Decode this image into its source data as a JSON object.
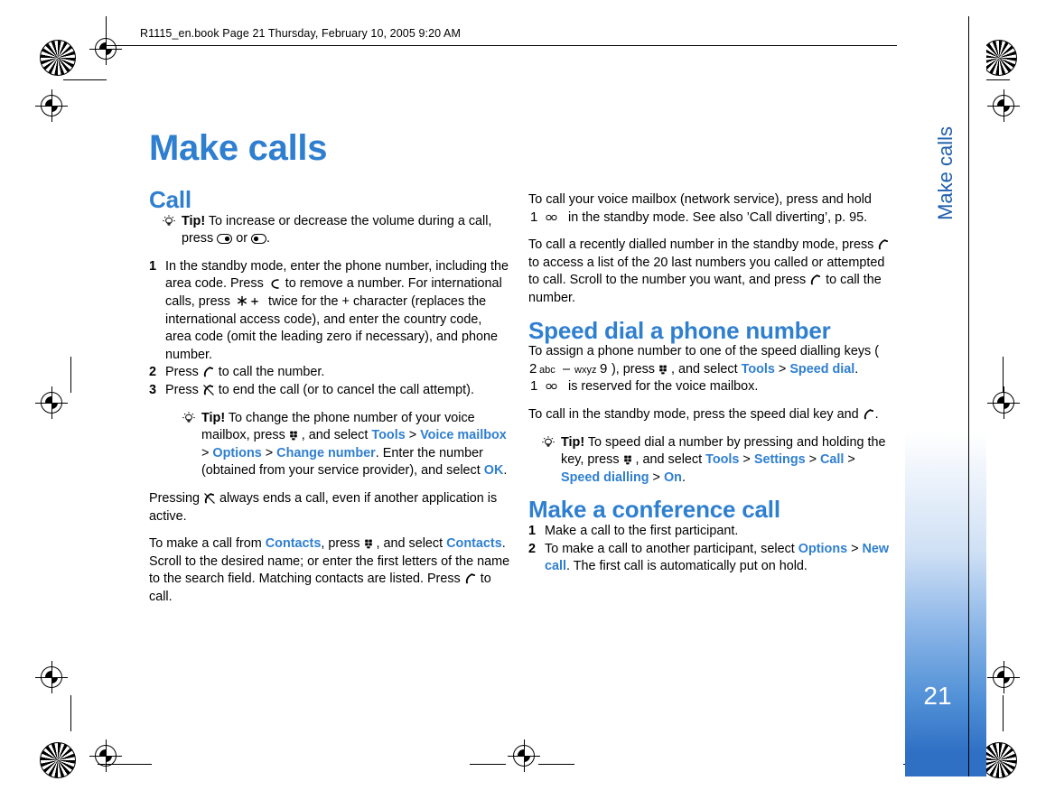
{
  "header": {
    "file_info": "R1115_en.book  Page 21  Thursday, February 10, 2005  9:20 AM"
  },
  "side_tab": {
    "title": "Make calls",
    "page_number": "21"
  },
  "title": "Make calls",
  "left_column": {
    "section_call": "Call",
    "tip1_label": "Tip!",
    "tip1_text_a": " To increase or decrease the volume during a call, press ",
    "tip1_text_or": " or ",
    "tip1_text_end": ".",
    "steps": [
      {
        "num": "1",
        "parts_a": "In the standby mode, enter the phone number, including the area code. Press ",
        "parts_b": " to remove a number. For international calls, press ",
        "parts_c": " twice for the + character (replaces the international access code), and enter the country code, area code (omit the leading zero if necessary), and phone number."
      },
      {
        "num": "2",
        "parts_a": "Press ",
        "parts_b": " to call the number."
      },
      {
        "num": "3",
        "parts_a": "Press ",
        "parts_b": " to end the call (or to cancel the call attempt)."
      }
    ],
    "tip2_label": "Tip!",
    "tip2_a": " To change the phone number of your voice mailbox, press ",
    "tip2_b": ", and select ",
    "tip2_tools": "Tools",
    "tip2_gt1": " > ",
    "tip2_voicemailbox": "Voice mailbox",
    "tip2_gt2": " > ",
    "tip2_options": "Options",
    "tip2_gt3": " > ",
    "tip2_changenumber": "Change number",
    "tip2_c": ". Enter the number (obtained from your service provider), and select ",
    "tip2_ok": "OK",
    "tip2_d": ".",
    "para_pressing_a": "Pressing ",
    "para_pressing_b": " always ends a call, even if another application is active.",
    "para_contacts_a": "To make a call from ",
    "para_contacts_link1": "Contacts",
    "para_contacts_b": ", press ",
    "para_contacts_c": ", and select ",
    "para_contacts_link2": "Contacts",
    "para_contacts_d": ". Scroll to the desired name; or enter the first letters of the name to the search field. Matching contacts are listed. Press ",
    "para_contacts_e": " to call."
  },
  "right_column": {
    "para_voicemail_a": "To call your voice mailbox (network service), press and hold ",
    "para_voicemail_b": " in the standby mode. See also ’Call diverting’, p. 95.",
    "para_recent_a": "To call a recently dialled number in the standby mode, press ",
    "para_recent_b": " to access a list of the 20 last numbers you called or attempted to call. Scroll to the number you want, and press ",
    "para_recent_c": " to call the number.",
    "section_speed_dial": "Speed dial a phone number",
    "para_assign_a": "To assign a phone number to one of the speed dialling keys (",
    "para_assign_dash": " – ",
    "para_assign_b": "), press ",
    "para_assign_c": ", and select ",
    "para_assign_tools": "Tools",
    "para_assign_gt1": " > ",
    "para_assign_speeddial": "Speed dial",
    "para_assign_d": ". ",
    "para_assign_e": " is reserved for the voice mailbox.",
    "para_speeddialcall_a": "To call in the standby mode, press the speed dial key and ",
    "para_speeddialcall_b": ".",
    "tip_label": "Tip!",
    "tip_a": " To speed dial a number by pressing and holding the key, press ",
    "tip_b": ", and select ",
    "tip_tools": "Tools",
    "tip_gt1": " > ",
    "tip_settings": "Settings",
    "tip_gt2": " > ",
    "tip_call": "Call",
    "tip_gt3": " > ",
    "tip_speeddialling": "Speed dialling",
    "tip_gt4": " > ",
    "tip_on": "On",
    "tip_c": ".",
    "section_conference": "Make a conference call",
    "steps": [
      {
        "num": "1",
        "text": "Make a call to the first participant."
      },
      {
        "num": "2",
        "parts_a": "To make a call to another participant, select ",
        "parts_options": "Options",
        "parts_gt": " > ",
        "parts_newcall": "New call",
        "parts_b": ". The first call is automatically put on hold."
      }
    ]
  },
  "icons": {
    "tip": "lightbulb-icon",
    "volume_down": "volume-down-key-icon",
    "volume_up": "volume-up-key-icon",
    "clear": "clear-key-icon",
    "star": "star-key-icon",
    "call": "call-key-icon",
    "end": "end-key-icon",
    "menu": "menu-key-icon",
    "key1": "key-1-icon",
    "key2": "key-2-abc-icon",
    "key9": "key-9-wxyz-icon"
  },
  "colors": {
    "accent_blue": "#2f7fd0",
    "tab_blue": "#2f6fc4"
  }
}
